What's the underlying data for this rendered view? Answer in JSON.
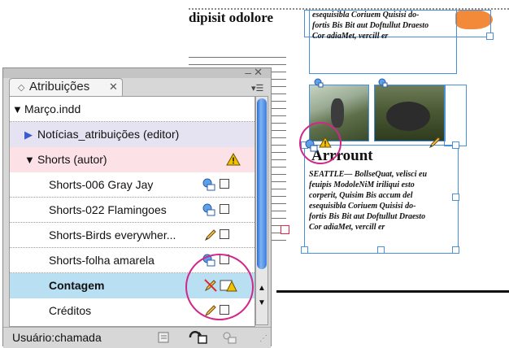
{
  "document": {
    "heading": "dipisit odolore",
    "story_top": [
      "esequisibla Coriuem Quisisi do-",
      "fortis Bis Bit aut Doftullut Draesto",
      "Cor adiaMet, vercill er"
    ],
    "story_title": "Arrrount",
    "story_body": [
      "SEATTLE— BollseQuat, velisci eu",
      "feuipis ModoleNiM iriliqui esto",
      "corperit, Quisim Bis accum del",
      "esequisibla Coriuem Quisisi do-",
      "fortis Bis Bit aut Doftullut Draesto",
      "Cor adiaMet, vercill er"
    ]
  },
  "panel": {
    "tab_label": "Atribuições",
    "rows": [
      {
        "label": "Março.indd"
      },
      {
        "label": "Notícias_atribuições (editor)"
      },
      {
        "label": "Shorts (autor)"
      },
      {
        "label": "Shorts-006 Gray Jay"
      },
      {
        "label": "Shorts-022 Flamingoes"
      },
      {
        "label": "Shorts-Birds everywher..."
      },
      {
        "label": "Shorts-folha amarela"
      },
      {
        "label": "Contagem"
      },
      {
        "label": "Créditos"
      }
    ],
    "footer_user": "Usuário:chamada"
  },
  "colors": {
    "frame_blue": "#4a90d9",
    "highlight_circle": "#d1268a",
    "selected_row": "#b9dff3",
    "assignment_row": "#e5e3f2",
    "author_row": "#fce1e6",
    "warning": "#f2c200",
    "scroll_thumb": "#3a7be0"
  },
  "icons": [
    "warning-icon",
    "linked-story-icon",
    "checkout-box-icon",
    "pencil-icon",
    "pencil-conflict-icon",
    "text-warning-icon",
    "update-icon",
    "assign-icon",
    "new-assignment-icon"
  ]
}
